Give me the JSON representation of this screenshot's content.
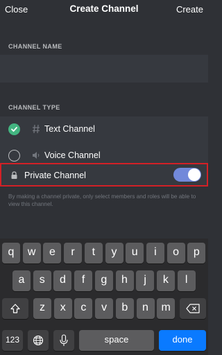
{
  "nav": {
    "close_label": "Close",
    "title": "Create Channel",
    "create_label": "Create"
  },
  "channel_name": {
    "section_label": "CHANNEL NAME",
    "value": "",
    "placeholder": ""
  },
  "channel_type": {
    "section_label": "CHANNEL TYPE",
    "options": [
      {
        "label": "Text Channel",
        "selected": true,
        "icon": "hash-icon"
      },
      {
        "label": "Voice Channel",
        "selected": false,
        "icon": "speaker-icon"
      }
    ]
  },
  "private": {
    "label": "Private Channel",
    "enabled": true,
    "icon": "lock-icon",
    "helper_text": "By making a channel private, only select members and roles will be able to view this channel."
  },
  "keyboard": {
    "row1": [
      "q",
      "w",
      "e",
      "r",
      "t",
      "y",
      "u",
      "i",
      "o",
      "p"
    ],
    "row2": [
      "a",
      "s",
      "d",
      "f",
      "g",
      "h",
      "j",
      "k",
      "l"
    ],
    "row3": [
      "z",
      "x",
      "c",
      "v",
      "b",
      "n",
      "m"
    ],
    "numbers_label": "123",
    "space_label": "space",
    "done_label": "done"
  },
  "colors": {
    "accent": "#7289da",
    "radio_selected": "#43b581",
    "highlight_border": "#d32026",
    "done_key": "#0a7aff"
  }
}
